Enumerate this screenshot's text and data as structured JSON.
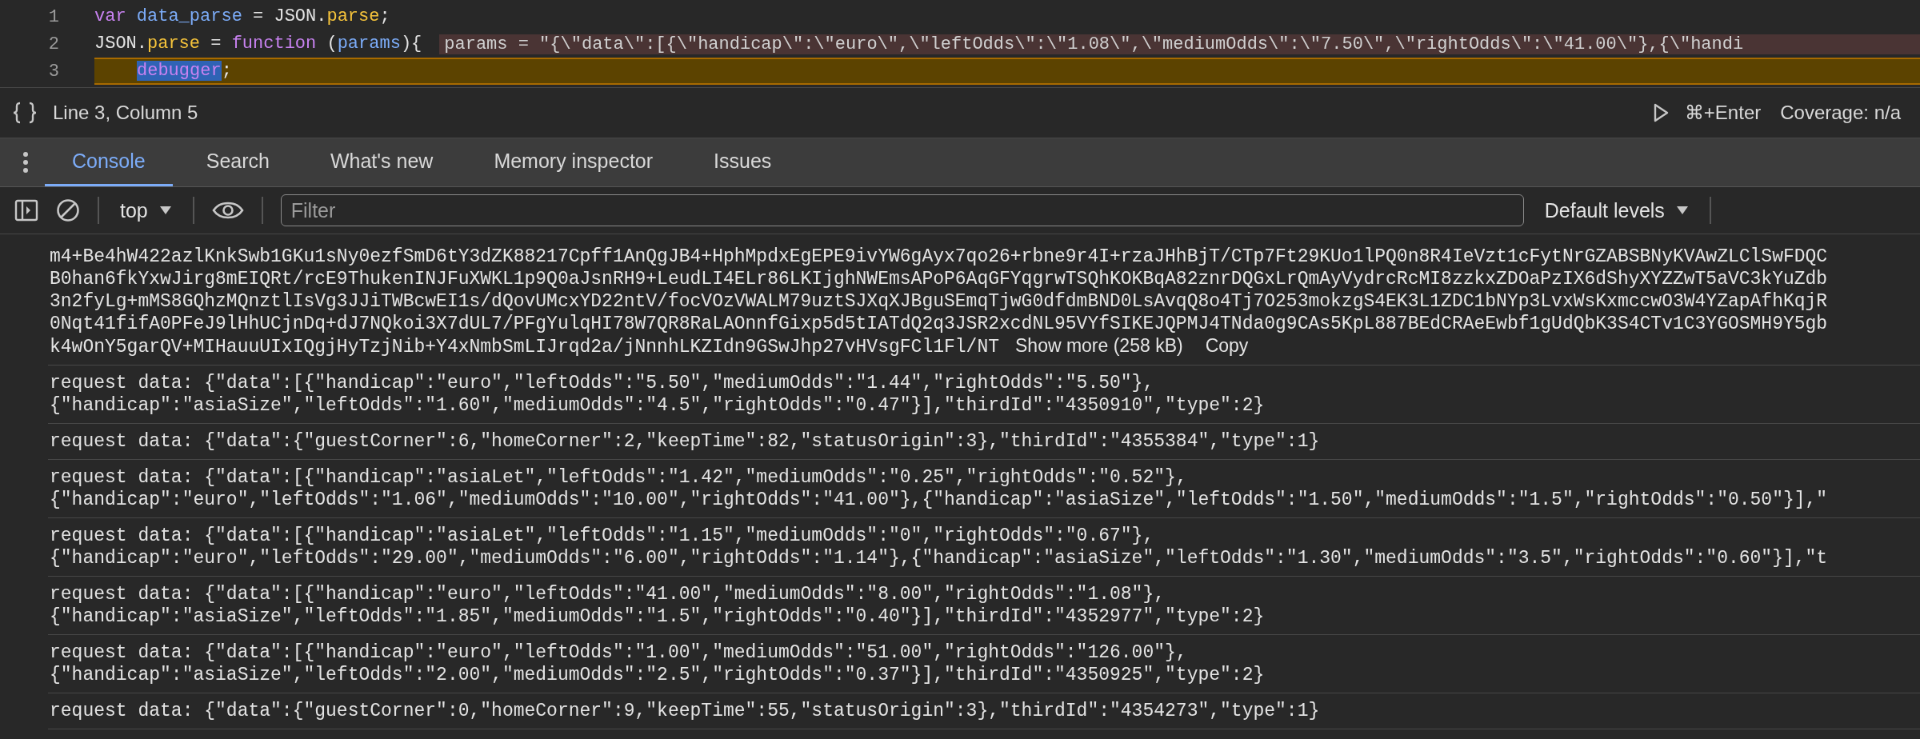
{
  "code": {
    "lines": [
      {
        "number": "1",
        "paused": false,
        "indented": false,
        "tokens": [
          {
            "text": "var",
            "kind": "keyword",
            "selected": false
          },
          {
            "text": " data_parse",
            "kind": "variable",
            "selected": false
          },
          {
            "text": " = JSON.",
            "kind": "plain",
            "selected": false
          },
          {
            "text": "parse",
            "kind": "property",
            "selected": false
          },
          {
            "text": ";",
            "kind": "plain",
            "selected": false
          }
        ]
      },
      {
        "number": "2",
        "paused": false,
        "indented": false,
        "tokens": [
          {
            "text": "JSON.",
            "kind": "plain",
            "selected": false
          },
          {
            "text": "parse",
            "kind": "property",
            "selected": false
          },
          {
            "text": " = ",
            "kind": "plain",
            "selected": false
          },
          {
            "text": "function",
            "kind": "keyword",
            "selected": false
          },
          {
            "text": " (",
            "kind": "plain",
            "selected": false
          },
          {
            "text": "params",
            "kind": "variable",
            "selected": false
          },
          {
            "text": "){",
            "kind": "plain",
            "selected": false
          }
        ],
        "inline_value": "params = \"{\\\"data\\\":[{\\\"handicap\\\":\\\"euro\\\",\\\"leftOdds\\\":\\\"1.08\\\",\\\"mediumOdds\\\":\\\"7.50\\\",\\\"rightOdds\\\":\\\"41.00\\\"},{\\\"handi"
      },
      {
        "number": "3",
        "paused": true,
        "indented": true,
        "tokens": [
          {
            "text": "debugger",
            "kind": "keyword",
            "selected": true
          },
          {
            "text": ";",
            "kind": "plain",
            "selected": false
          }
        ]
      }
    ]
  },
  "status_bar": {
    "position": "Line 3, Column 5",
    "shortcut": "⌘+Enter",
    "coverage": "Coverage: n/a"
  },
  "tabs": [
    {
      "label": "Console",
      "selected": true
    },
    {
      "label": "Search",
      "selected": false
    },
    {
      "label": "What's new",
      "selected": false
    },
    {
      "label": "Memory inspector",
      "selected": false
    },
    {
      "label": "Issues",
      "selected": false
    }
  ],
  "toolbar": {
    "context": "top",
    "filter": {
      "placeholder": "Filter"
    },
    "levels": "Default levels"
  },
  "messages": [
    {
      "kind": "blob",
      "lines": [
        "m4+Be4hW422azlKnkSwb1GKu1sNy0ezfSmD6tY3dZK88217Cpff1AnQgJB4+HphMpdxEgEPE9ivYW6gAyx7qo26+rbne9r4I+rzaJHhBjT/CTp7Ft29KUo1lPQ0n8R4IeVzt1cFytNrGZABSBNyKVAwZLClSwFDQC",
        "B0han6fkYxwJirg8mEIQRt/rcE9ThukenINJFuXWKL1p9Q0aJsnRH9+LeudLI4ELr86LKIjghNWEmsAPoP6AqGFYqgrwTSQhKOKBqA82znrDQGxLrQmAyVydrcRcMI8zzkxZDOaPzIX6dShyXYZZwT5aVC3kYuZdb",
        "3n2fyLg+mMS8GQhzMQnztlIsVg3JJiTWBcwEI1s/dQovUMcxYD22ntV/focVOzVWALM79uztSJXqXJBguSEmqTjwG0dfdmBND0LsAvqQ8o4Tj7O253mokzgS4EK3L1ZDC1bNYp3LvxWsKxmccwO3W4YZapAfhKqjR",
        "0Nqt41fifA0PFeJ9lHhUCjnDq+dJ7NQkoi3X7dUL7/PFgYulqHI78W7QR8RaLAOnnfGixp5d5tIATdQ2q3JSR2xcdNL95VYfSIKEJQPMJ4TNda0g9CAs5KpL887BEdCRAeEwbf1gUdQbK3S4CTv1C3YGOSMH9Y5gb",
        "k4wOnY5garQV+MIHauuUIxIQgjHyTzjNib+Y4xNmbSmLIJrqd2a/jNnnhLKZIdn9GSwJhp27vHVsgFCl1Fl/NT"
      ],
      "show_more": "Show more (258 kB)",
      "copy": "Copy"
    },
    {
      "kind": "log",
      "lines": [
        "request data: {\"data\":[{\"handicap\":\"euro\",\"leftOdds\":\"5.50\",\"mediumOdds\":\"1.44\",\"rightOdds\":\"5.50\"},",
        "{\"handicap\":\"asiaSize\",\"leftOdds\":\"1.60\",\"mediumOdds\":\"4.5\",\"rightOdds\":\"0.47\"}],\"thirdId\":\"4350910\",\"type\":2}"
      ]
    },
    {
      "kind": "log",
      "lines": [
        "request data: {\"data\":{\"guestCorner\":6,\"homeCorner\":2,\"keepTime\":82,\"statusOrigin\":3},\"thirdId\":\"4355384\",\"type\":1}"
      ]
    },
    {
      "kind": "log",
      "lines": [
        "request data: {\"data\":[{\"handicap\":\"asiaLet\",\"leftOdds\":\"1.42\",\"mediumOdds\":\"0.25\",\"rightOdds\":\"0.52\"},",
        "{\"handicap\":\"euro\",\"leftOdds\":\"1.06\",\"mediumOdds\":\"10.00\",\"rightOdds\":\"41.00\"},{\"handicap\":\"asiaSize\",\"leftOdds\":\"1.50\",\"mediumOdds\":\"1.5\",\"rightOdds\":\"0.50\"}],\""
      ]
    },
    {
      "kind": "log",
      "lines": [
        "request data: {\"data\":[{\"handicap\":\"asiaLet\",\"leftOdds\":\"1.15\",\"mediumOdds\":\"0\",\"rightOdds\":\"0.67\"},",
        "{\"handicap\":\"euro\",\"leftOdds\":\"29.00\",\"mediumOdds\":\"6.00\",\"rightOdds\":\"1.14\"},{\"handicap\":\"asiaSize\",\"leftOdds\":\"1.30\",\"mediumOdds\":\"3.5\",\"rightOdds\":\"0.60\"}],\"t"
      ]
    },
    {
      "kind": "log",
      "lines": [
        "request data: {\"data\":[{\"handicap\":\"euro\",\"leftOdds\":\"41.00\",\"mediumOdds\":\"8.00\",\"rightOdds\":\"1.08\"},",
        "{\"handicap\":\"asiaSize\",\"leftOdds\":\"1.85\",\"mediumOdds\":\"1.5\",\"rightOdds\":\"0.40\"}],\"thirdId\":\"4352977\",\"type\":2}"
      ]
    },
    {
      "kind": "log",
      "lines": [
        "request data: {\"data\":[{\"handicap\":\"euro\",\"leftOdds\":\"1.00\",\"mediumOdds\":\"51.00\",\"rightOdds\":\"126.00\"},",
        "{\"handicap\":\"asiaSize\",\"leftOdds\":\"2.00\",\"mediumOdds\":\"2.5\",\"rightOdds\":\"0.37\"}],\"thirdId\":\"4350925\",\"type\":2}"
      ]
    },
    {
      "kind": "log",
      "lines": [
        "request data: {\"data\":{\"guestCorner\":0,\"homeCorner\":9,\"keepTime\":55,\"statusOrigin\":3},\"thirdId\":\"4354273\",\"type\":1}"
      ]
    }
  ]
}
